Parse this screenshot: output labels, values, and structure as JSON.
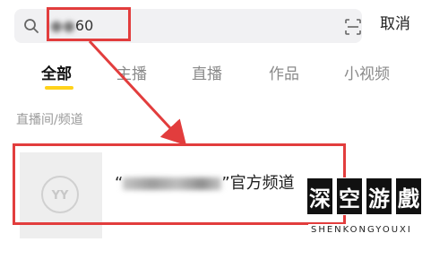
{
  "search": {
    "value_hidden": "●●",
    "value_visible": "60",
    "cancel_label": "取消"
  },
  "tabs": [
    {
      "label": "全部",
      "active": true
    },
    {
      "label": "主播",
      "active": false
    },
    {
      "label": "直播",
      "active": false
    },
    {
      "label": "作品",
      "active": false
    },
    {
      "label": "小视频",
      "active": false
    }
  ],
  "section_label": "直播间/频道",
  "result": {
    "open_quote": "“",
    "close_quote": "”",
    "suffix": "官方频道",
    "logo_text": "YY"
  },
  "watermark": {
    "chars": [
      "深",
      "空",
      "游",
      "戲"
    ],
    "sub": "SHENKONGYOUXI"
  },
  "colors": {
    "accent_yellow": "#ffd21a",
    "annotation_red": "#e23d3d"
  },
  "icons": [
    "search-icon",
    "scan-icon",
    "yy-logo-icon"
  ]
}
